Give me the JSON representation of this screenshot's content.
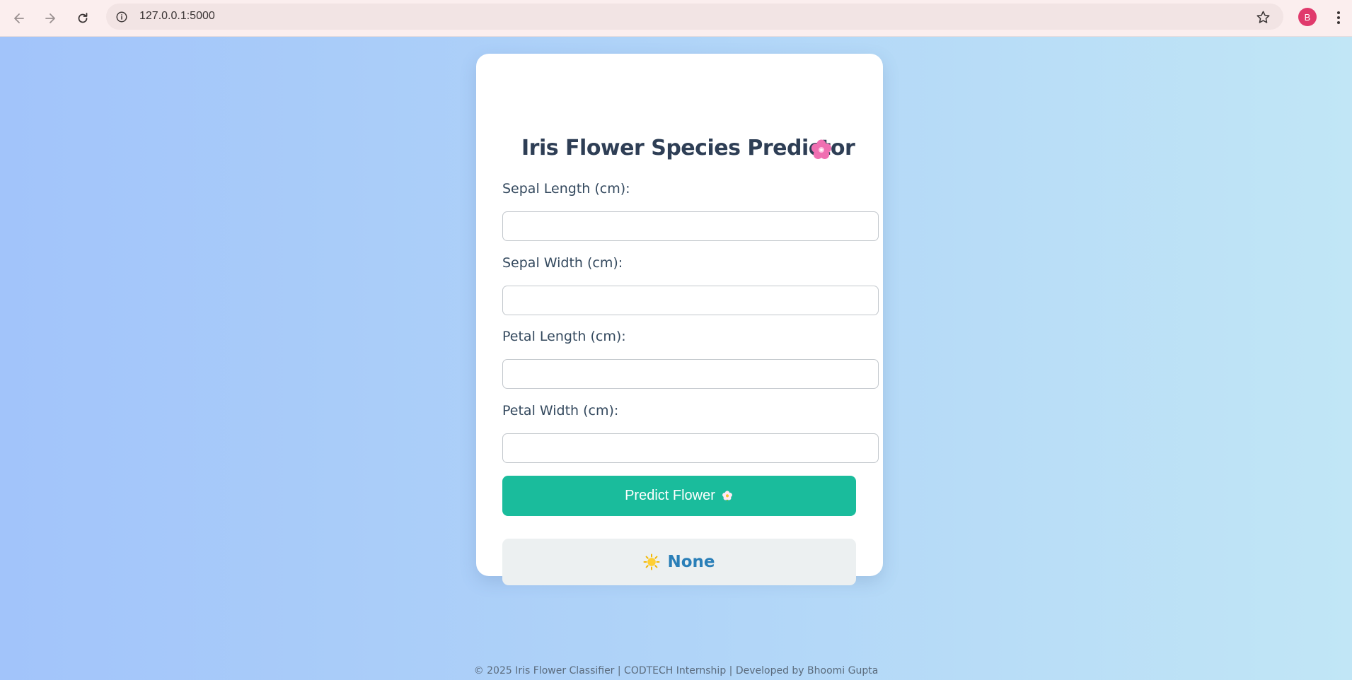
{
  "browser": {
    "url": "127.0.0.1:5000",
    "profile_initial": "B",
    "icons": [
      "back-icon",
      "forward-icon",
      "reload-icon",
      "site-info-icon",
      "bookmark-star-icon",
      "more-menu-icon"
    ]
  },
  "card": {
    "title": "Iris Flower Species Predictor",
    "title_icon": "cherry-blossom-icon",
    "fields": [
      {
        "label": "Sepal Length (cm):",
        "value": "",
        "placeholder": ""
      },
      {
        "label": "Sepal Width (cm):",
        "value": "",
        "placeholder": ""
      },
      {
        "label": "Petal Length (cm):",
        "value": "",
        "placeholder": ""
      },
      {
        "label": "Petal Width (cm):",
        "value": "",
        "placeholder": ""
      }
    ],
    "predict_button": {
      "label": "Predict Flower",
      "icon": "blossom-icon"
    },
    "result": {
      "icon": "sun-icon",
      "text": "None"
    }
  },
  "footer": {
    "text": "© 2025 Iris Flower Classifier | CODTECH Internship | Developed by Bhoomi Gupta"
  },
  "colors": {
    "accent": "#1abc9c",
    "result_text": "#2a7fb8",
    "title_text": "#2e3e55",
    "avatar": "#e03a6c"
  }
}
